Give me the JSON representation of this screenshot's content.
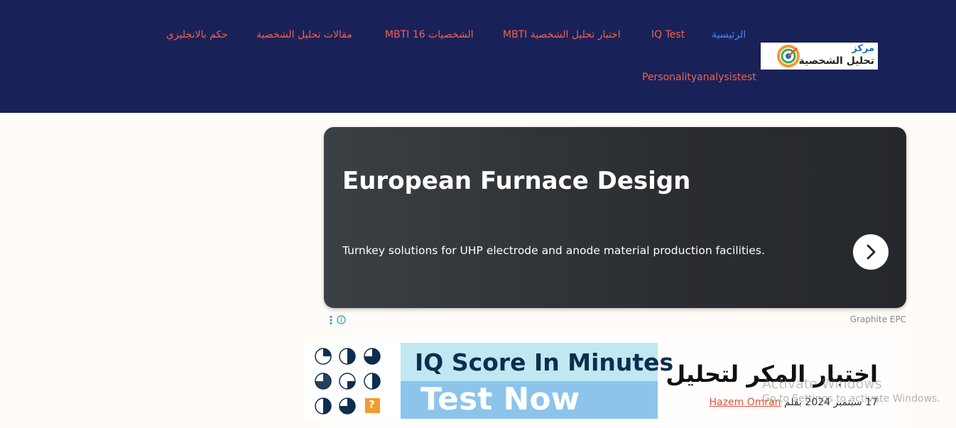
{
  "nav": {
    "items": [
      {
        "label": "الرئيسية",
        "active": true
      },
      {
        "label": "IQ Test"
      },
      {
        "label": "اختبار تحليل الشخصية MBTI"
      },
      {
        "label": "الشخصيات 16 MBTI"
      },
      {
        "label": "مقالات تحليل الشخصية"
      },
      {
        "label": "حكم بالانجليزي"
      },
      {
        "label": "Personalityanalysistest"
      }
    ]
  },
  "logo": {
    "line1": "مركز",
    "line2": "تحليل الشخصية"
  },
  "ad": {
    "title": "European Furnace Design",
    "description": "Turnkey solutions for UHP electrode and anode material production facilities.",
    "source": "Graphite EPC"
  },
  "article": {
    "title": "اختبار المكر لتحليل شخ",
    "date": "17 سبتمبر 2024",
    "by": "بقلم",
    "author": "Hazem Omran"
  },
  "iq_banner": {
    "top_text": "IQ Score In Minutes",
    "bottom_text": "Test Now",
    "question_mark": "?"
  },
  "watermark": {
    "line1": "Activate Windows",
    "line2": "Go to Settings to activate Windows."
  },
  "colors": {
    "header_bg": "#192159",
    "nav_link": "#f2624a",
    "nav_active": "#3d8ef0",
    "page_bg": "#fffbf7"
  }
}
